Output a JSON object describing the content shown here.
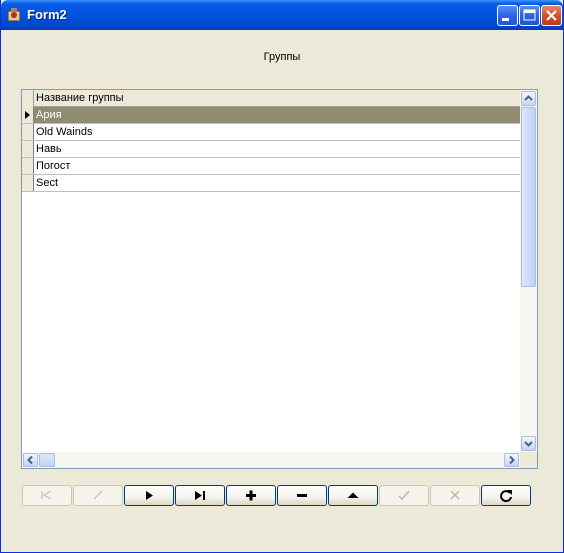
{
  "window": {
    "title": "Form2"
  },
  "caption": "Группы",
  "grid": {
    "column_header": "Название группы",
    "rows": [
      "Ария",
      "Old Wainds",
      "Навь",
      "Погост",
      "Sect"
    ],
    "selected_index": 0
  },
  "navigator": {
    "buttons": [
      {
        "name": "first-record",
        "enabled": false,
        "icon": "first-icon"
      },
      {
        "name": "prior-record",
        "enabled": false,
        "icon": "prior-icon"
      },
      {
        "name": "next-record",
        "enabled": true,
        "icon": "next-icon"
      },
      {
        "name": "last-record",
        "enabled": true,
        "icon": "last-icon"
      },
      {
        "name": "insert-record",
        "enabled": true,
        "icon": "plus-icon"
      },
      {
        "name": "delete-record",
        "enabled": true,
        "icon": "minus-icon"
      },
      {
        "name": "edit-record",
        "enabled": true,
        "icon": "up-triangle-icon"
      },
      {
        "name": "post-record",
        "enabled": false,
        "icon": "check-icon"
      },
      {
        "name": "cancel-record",
        "enabled": false,
        "icon": "cancel-icon"
      },
      {
        "name": "refresh-record",
        "enabled": true,
        "icon": "refresh-icon"
      }
    ]
  },
  "colors": {
    "selection": "#8f8c72",
    "titlebar": "#0054e3",
    "window_bg": "#ece9d8"
  }
}
